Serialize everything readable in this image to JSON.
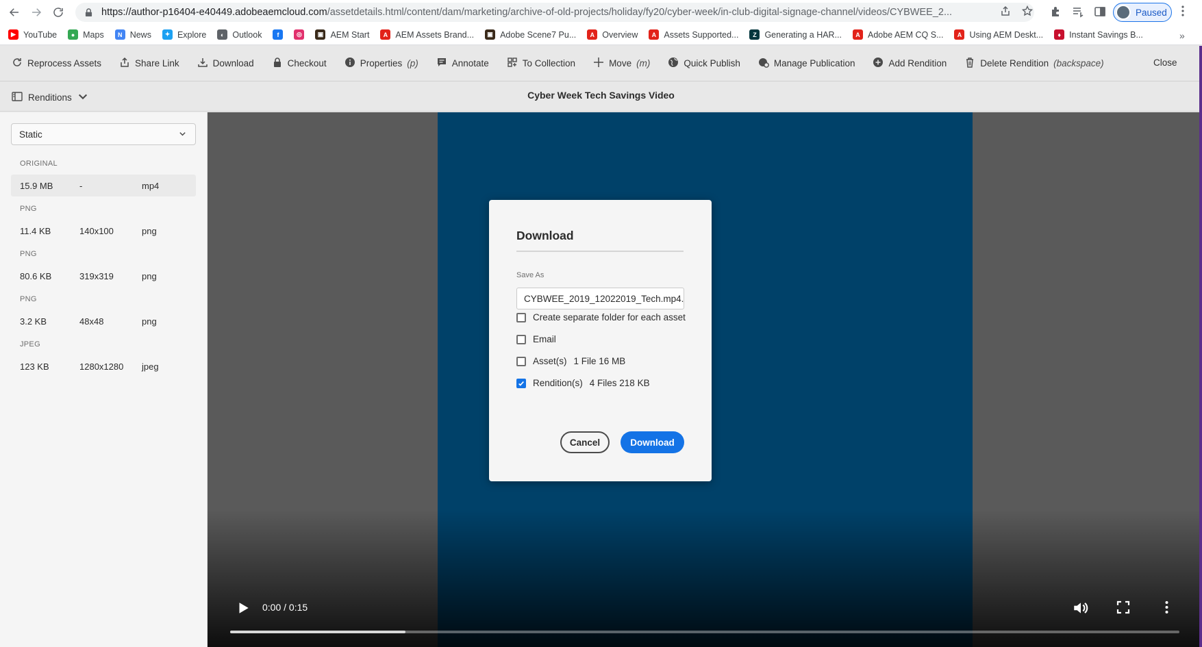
{
  "browser": {
    "url_host": "https://author-p16404-e40449.adobeaemcloud.com",
    "url_path": "/assetdetails.html/content/dam/marketing/archive-of-old-projects/holiday/fy20/cyber-week/in-club-digital-signage-channel/videos/CYBWEE_2...",
    "profile_label": "Paused",
    "bookmarks": [
      {
        "label": "YouTube",
        "color": "#ff0000",
        "icon": "youtube-icon"
      },
      {
        "label": "Maps",
        "color": "#34a853",
        "icon": "maps-icon"
      },
      {
        "label": "News",
        "color": "#4285f4",
        "icon": "news-icon"
      },
      {
        "label": "Explore",
        "color": "#1da1f2",
        "icon": "twitter-icon"
      },
      {
        "label": "Outlook",
        "color": "#5f6368",
        "icon": "globe-icon"
      },
      {
        "label": "",
        "color": "#1877f2",
        "icon": "facebook-icon"
      },
      {
        "label": "",
        "color": "#e1306c",
        "icon": "instagram-icon"
      },
      {
        "label": "AEM Start",
        "color": "#3a2a1a",
        "icon": "aem-icon"
      },
      {
        "label": "AEM Assets Brand...",
        "color": "#e2231a",
        "icon": "adobe-icon"
      },
      {
        "label": "Adobe Scene7 Pu...",
        "color": "#3a2a1a",
        "icon": "aem-icon"
      },
      {
        "label": "Overview",
        "color": "#e2231a",
        "icon": "adobe-icon"
      },
      {
        "label": "Assets Supported...",
        "color": "#e2231a",
        "icon": "adobe-icon"
      },
      {
        "label": "Generating a HAR...",
        "color": "#03363d",
        "icon": "zendesk-icon"
      },
      {
        "label": "Adobe AEM CQ S...",
        "color": "#e2231a",
        "icon": "adobe-icon"
      },
      {
        "label": "Using AEM Deskt...",
        "color": "#e2231a",
        "icon": "adobe-icon"
      },
      {
        "label": "Instant Savings B...",
        "color": "#c8102e",
        "icon": "shield-icon"
      }
    ]
  },
  "actionbar": {
    "items": [
      {
        "label": "Reprocess Assets",
        "hotkey": "",
        "icon": "refresh-icon"
      },
      {
        "label": "Share Link",
        "hotkey": "",
        "icon": "share-icon"
      },
      {
        "label": "Download",
        "hotkey": "",
        "icon": "download-icon"
      },
      {
        "label": "Checkout",
        "hotkey": "",
        "icon": "lock-icon"
      },
      {
        "label": "Properties",
        "hotkey": "(p)",
        "icon": "info-icon"
      },
      {
        "label": "Annotate",
        "hotkey": "",
        "icon": "comment-icon"
      },
      {
        "label": "To Collection",
        "hotkey": "",
        "icon": "collection-icon"
      },
      {
        "label": "Move",
        "hotkey": "(m)",
        "icon": "move-icon"
      },
      {
        "label": "Quick Publish",
        "hotkey": "",
        "icon": "globe-icon"
      },
      {
        "label": "Manage Publication",
        "hotkey": "",
        "icon": "globe-gear-icon"
      },
      {
        "label": "Add Rendition",
        "hotkey": "",
        "icon": "add-circle-icon"
      },
      {
        "label": "Delete Rendition",
        "hotkey": "(backspace)",
        "icon": "trash-icon"
      }
    ],
    "close_label": "Close"
  },
  "subheader": {
    "rail_label": "Renditions",
    "title": "Cyber Week Tech Savings Video"
  },
  "rail": {
    "select_value": "Static",
    "groups": [
      {
        "label": "ORIGINAL",
        "size": "15.9 MB",
        "dims": "-",
        "format": "mp4",
        "selected": true
      },
      {
        "label": "PNG",
        "size": "11.4 KB",
        "dims": "140x100",
        "format": "png",
        "selected": false
      },
      {
        "label": "PNG",
        "size": "80.6 KB",
        "dims": "319x319",
        "format": "png",
        "selected": false
      },
      {
        "label": "PNG",
        "size": "3.2 KB",
        "dims": "48x48",
        "format": "png",
        "selected": false
      },
      {
        "label": "JPEG",
        "size": "123 KB",
        "dims": "1280x1280",
        "format": "jpeg",
        "selected": false
      }
    ]
  },
  "video": {
    "time": "0:00 / 0:15",
    "progress": 0.185,
    "frame_color": "#004169"
  },
  "dialog": {
    "title": "Download",
    "save_as_label": "Save As",
    "save_as_value": "CYBWEE_2019_12022019_Tech.mp4....",
    "options": [
      {
        "label": "Create separate folder for each asset",
        "meta": "",
        "checked": false
      },
      {
        "label": "Email",
        "meta": "",
        "checked": false
      },
      {
        "label": "Asset(s)",
        "meta": "1 File 16 MB",
        "checked": false
      },
      {
        "label": "Rendition(s)",
        "meta": "4 Files 218 KB",
        "checked": true
      }
    ],
    "cancel_label": "Cancel",
    "download_label": "Download",
    "accent": "#1473e6"
  }
}
